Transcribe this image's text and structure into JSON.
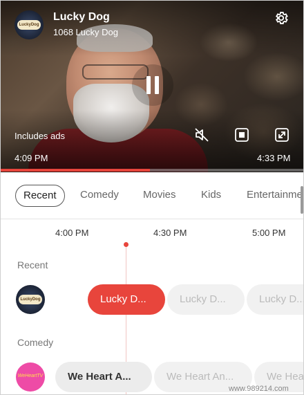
{
  "player": {
    "channel_name": "Lucky Dog",
    "channel_number_label": "1068 Lucky Dog",
    "logo_text": "LuckyDog",
    "ads_label": "Includes ads",
    "time_start": "4:09 PM",
    "time_end": "4:33 PM",
    "progress_fraction": 0.49,
    "accent_color": "#e8453c",
    "icons": [
      "gear-icon",
      "pause-icon",
      "mute-icon",
      "stop-icon",
      "fullscreen-icon"
    ]
  },
  "tabs": [
    {
      "label": "Recent",
      "active": true
    },
    {
      "label": "Comedy",
      "active": false
    },
    {
      "label": "Movies",
      "active": false
    },
    {
      "label": "Kids",
      "active": false
    },
    {
      "label": "Entertainme",
      "active": false
    }
  ],
  "guide": {
    "times": [
      "4:00 PM",
      "4:30 PM",
      "5:00 PM"
    ],
    "sections": [
      {
        "name": "Recent",
        "logo_text": "LuckyDog",
        "programs": [
          "Lucky D...",
          "Lucky D...",
          "Lucky D..."
        ]
      },
      {
        "name": "Comedy",
        "logo_text": "WeHeartTV",
        "programs": [
          "We Heart A...",
          "We Heart An...",
          "We Hea"
        ]
      }
    ]
  },
  "watermark": "www.989214.com"
}
